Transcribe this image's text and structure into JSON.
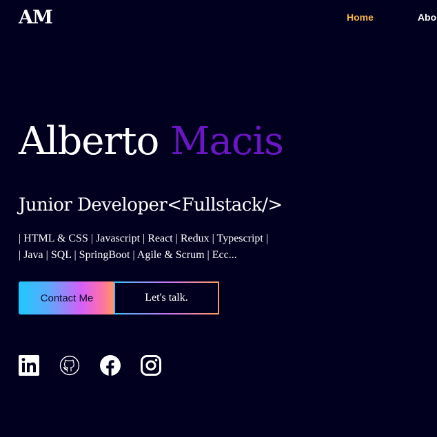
{
  "header": {
    "logo": "AM",
    "nav": {
      "home": "Home",
      "about": "Abo"
    }
  },
  "hero": {
    "first_name": "Alberto",
    "last_name": "Macis",
    "role": "Junior Developer<Fullstack/>",
    "skills_line1": "| HTML & CSS | Javascript | React | Redux | Typescript |",
    "skills_line2": "| Java | SQL | SpringBoot | Agile & Scrum | Ecc...",
    "contact_button": "Contact Me",
    "talk_button": "Let's talk."
  },
  "socials": [
    {
      "icon": "linkedin-icon"
    },
    {
      "icon": "github-icon"
    },
    {
      "icon": "facebook-icon"
    },
    {
      "icon": "instagram-icon"
    }
  ],
  "colors": {
    "background": "#02001f",
    "accent_purple": "#6a16c2",
    "nav_active": "#f6b845"
  }
}
